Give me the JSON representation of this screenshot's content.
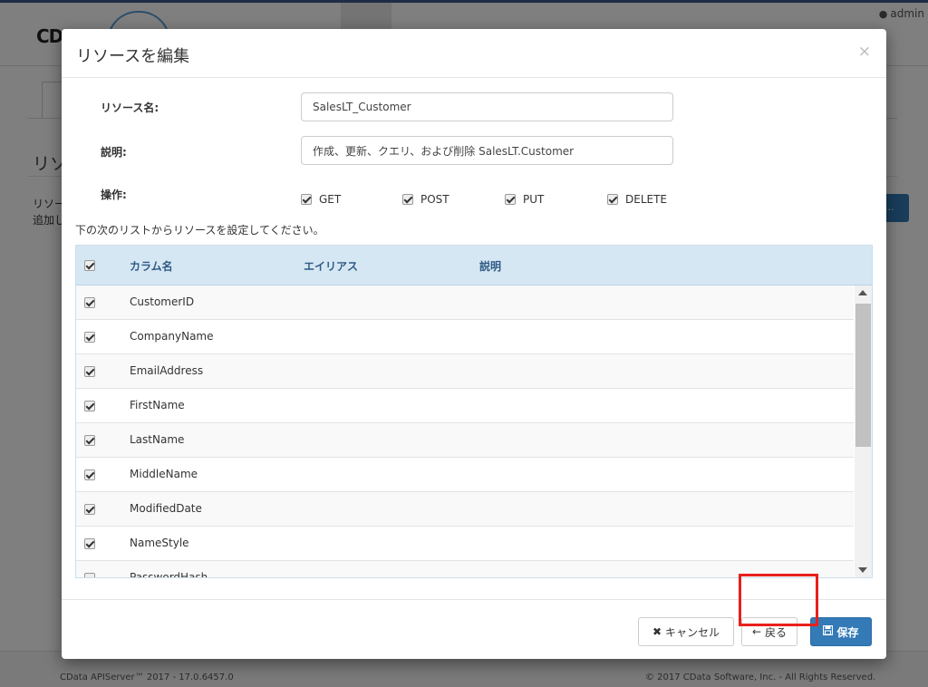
{
  "background": {
    "logo_text": "CD",
    "user_label": "admin",
    "section_title": "リソ",
    "line1": "リソー",
    "line2": "追加し",
    "button_label": "...",
    "footer_left": "CData APIServer™ 2017 - 17.0.6457.0",
    "footer_right": "© 2017 CData Software, Inc. - All Rights Reserved."
  },
  "modal": {
    "title": "リソースを編集",
    "close": "×",
    "resource_name_label": "リソース名:",
    "resource_name_value": "SalesLT_Customer",
    "description_label": "説明:",
    "description_value": "作成、更新、クエリ、および削除 SalesLT.Customer",
    "operations_label": "操作:",
    "operations": [
      {
        "label": "GET",
        "checked": true
      },
      {
        "label": "POST",
        "checked": true
      },
      {
        "label": "PUT",
        "checked": true
      },
      {
        "label": "DELETE",
        "checked": true
      }
    ],
    "hint": "下の次のリストからリソースを設定してください。"
  },
  "table": {
    "headers": {
      "column_name": "カラム名",
      "alias": "エイリアス",
      "description": "説明"
    },
    "rows": [
      {
        "name": "CustomerID",
        "checked": true
      },
      {
        "name": "CompanyName",
        "checked": true
      },
      {
        "name": "EmailAddress",
        "checked": true
      },
      {
        "name": "FirstName",
        "checked": true
      },
      {
        "name": "LastName",
        "checked": true
      },
      {
        "name": "MiddleName",
        "checked": true
      },
      {
        "name": "ModifiedDate",
        "checked": true
      },
      {
        "name": "NameStyle",
        "checked": true
      },
      {
        "name": "PasswordHash",
        "checked": false
      }
    ]
  },
  "footer": {
    "cancel_label": "キャンセル",
    "back_label": "戻る",
    "save_label": "保存"
  },
  "colors": {
    "primary": "#337ab7",
    "highlight": "#e8201c",
    "table_header": "#d6e7f4"
  }
}
